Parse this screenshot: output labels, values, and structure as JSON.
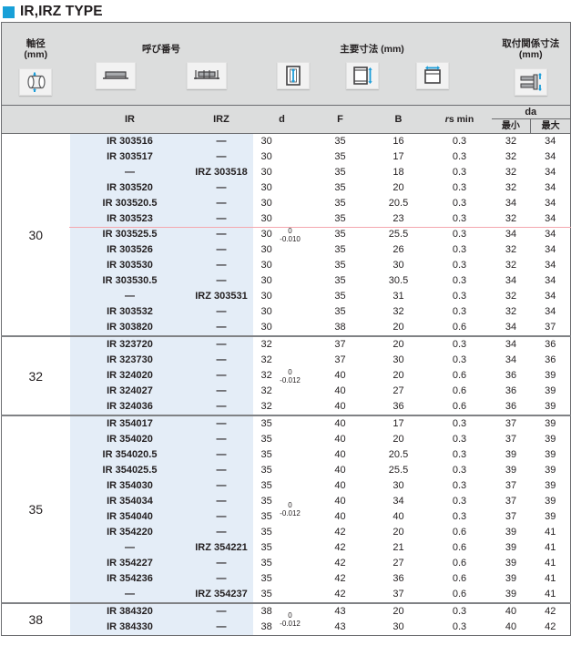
{
  "title": {
    "text": "IR,IRZ TYPE",
    "marker_color": "#18a0d8"
  },
  "header": {
    "shaft": {
      "line1": "軸径",
      "line2": "(mm)",
      "icon": "shaft-diameter-icon"
    },
    "designation": {
      "label": "呼び番号",
      "icons": [
        "ir-profile-icon",
        "irz-profile-icon"
      ]
    },
    "main_dims": {
      "label": "主要寸法 (mm)",
      "icons": [
        "dimension-d-icon",
        "dimension-f-icon",
        "dimension-b-icon"
      ]
    },
    "mounting": {
      "line1": "取付関係寸法",
      "line2": "(mm)",
      "icon": "mounting-dimension-icon"
    },
    "sub": {
      "ir": "IR",
      "irz": "IRZ",
      "d": "d",
      "f": "F",
      "b": "B",
      "rs_min_prefix": "r",
      "rs_min_suffix": "s min",
      "da": "da",
      "da_min": "最小",
      "da_max": "最大"
    }
  },
  "colors": {
    "name_bg": "#e4edf7",
    "header_bg": "#dcdddd",
    "highlight_line": "#f4a7ae",
    "accent": "#18a0d8",
    "border": "#6d6e71"
  },
  "dash": "—",
  "blocks": [
    {
      "shaft": "30",
      "tolerance": {
        "upper": "0",
        "lower": "-0.010"
      },
      "highlight_after_row": 6,
      "rows": [
        {
          "ir": "IR 303516",
          "irz": "—",
          "d": "30",
          "f": "35",
          "b": "16",
          "rs": "0.3",
          "da_min": "32",
          "da_max": "34"
        },
        {
          "ir": "IR 303517",
          "irz": "—",
          "d": "30",
          "f": "35",
          "b": "17",
          "rs": "0.3",
          "da_min": "32",
          "da_max": "34"
        },
        {
          "ir": "—",
          "irz": "IRZ 303518",
          "d": "30",
          "f": "35",
          "b": "18",
          "rs": "0.3",
          "da_min": "32",
          "da_max": "34"
        },
        {
          "ir": "IR 303520",
          "irz": "—",
          "d": "30",
          "f": "35",
          "b": "20",
          "rs": "0.3",
          "da_min": "32",
          "da_max": "34"
        },
        {
          "ir": "IR 303520.5",
          "irz": "—",
          "d": "30",
          "f": "35",
          "b": "20.5",
          "rs": "0.3",
          "da_min": "34",
          "da_max": "34"
        },
        {
          "ir": "IR 303523",
          "irz": "—",
          "d": "30",
          "f": "35",
          "b": "23",
          "rs": "0.3",
          "da_min": "32",
          "da_max": "34"
        },
        {
          "ir": "IR 303525.5",
          "irz": "—",
          "d": "30",
          "f": "35",
          "b": "25.5",
          "rs": "0.3",
          "da_min": "34",
          "da_max": "34"
        },
        {
          "ir": "IR 303526",
          "irz": "—",
          "d": "30",
          "f": "35",
          "b": "26",
          "rs": "0.3",
          "da_min": "32",
          "da_max": "34"
        },
        {
          "ir": "IR 303530",
          "irz": "—",
          "d": "30",
          "f": "35",
          "b": "30",
          "rs": "0.3",
          "da_min": "32",
          "da_max": "34"
        },
        {
          "ir": "IR 303530.5",
          "irz": "—",
          "d": "30",
          "f": "35",
          "b": "30.5",
          "rs": "0.3",
          "da_min": "34",
          "da_max": "34"
        },
        {
          "ir": "—",
          "irz": "IRZ 303531",
          "d": "30",
          "f": "35",
          "b": "31",
          "rs": "0.3",
          "da_min": "32",
          "da_max": "34"
        },
        {
          "ir": "IR 303532",
          "irz": "—",
          "d": "30",
          "f": "35",
          "b": "32",
          "rs": "0.3",
          "da_min": "32",
          "da_max": "34"
        },
        {
          "ir": "IR 303820",
          "irz": "—",
          "d": "30",
          "f": "38",
          "b": "20",
          "rs": "0.6",
          "da_min": "34",
          "da_max": "37"
        }
      ]
    },
    {
      "shaft": "32",
      "tolerance": {
        "upper": "0",
        "lower": "-0.012"
      },
      "highlight_after_row": 0,
      "rows": [
        {
          "ir": "IR 323720",
          "irz": "—",
          "d": "32",
          "f": "37",
          "b": "20",
          "rs": "0.3",
          "da_min": "34",
          "da_max": "36"
        },
        {
          "ir": "IR 323730",
          "irz": "—",
          "d": "32",
          "f": "37",
          "b": "30",
          "rs": "0.3",
          "da_min": "34",
          "da_max": "36"
        },
        {
          "ir": "IR 324020",
          "irz": "—",
          "d": "32",
          "f": "40",
          "b": "20",
          "rs": "0.6",
          "da_min": "36",
          "da_max": "39"
        },
        {
          "ir": "IR 324027",
          "irz": "—",
          "d": "32",
          "f": "40",
          "b": "27",
          "rs": "0.6",
          "da_min": "36",
          "da_max": "39"
        },
        {
          "ir": "IR 324036",
          "irz": "—",
          "d": "32",
          "f": "40",
          "b": "36",
          "rs": "0.6",
          "da_min": "36",
          "da_max": "39"
        }
      ]
    },
    {
      "shaft": "35",
      "tolerance": {
        "upper": "0",
        "lower": "-0.012"
      },
      "highlight_after_row": 0,
      "rows": [
        {
          "ir": "IR 354017",
          "irz": "—",
          "d": "35",
          "f": "40",
          "b": "17",
          "rs": "0.3",
          "da_min": "37",
          "da_max": "39"
        },
        {
          "ir": "IR 354020",
          "irz": "—",
          "d": "35",
          "f": "40",
          "b": "20",
          "rs": "0.3",
          "da_min": "37",
          "da_max": "39"
        },
        {
          "ir": "IR 354020.5",
          "irz": "—",
          "d": "35",
          "f": "40",
          "b": "20.5",
          "rs": "0.3",
          "da_min": "39",
          "da_max": "39"
        },
        {
          "ir": "IR 354025.5",
          "irz": "—",
          "d": "35",
          "f": "40",
          "b": "25.5",
          "rs": "0.3",
          "da_min": "39",
          "da_max": "39"
        },
        {
          "ir": "IR 354030",
          "irz": "—",
          "d": "35",
          "f": "40",
          "b": "30",
          "rs": "0.3",
          "da_min": "37",
          "da_max": "39"
        },
        {
          "ir": "IR 354034",
          "irz": "—",
          "d": "35",
          "f": "40",
          "b": "34",
          "rs": "0.3",
          "da_min": "37",
          "da_max": "39"
        },
        {
          "ir": "IR 354040",
          "irz": "—",
          "d": "35",
          "f": "40",
          "b": "40",
          "rs": "0.3",
          "da_min": "37",
          "da_max": "39"
        },
        {
          "ir": "IR 354220",
          "irz": "—",
          "d": "35",
          "f": "42",
          "b": "20",
          "rs": "0.6",
          "da_min": "39",
          "da_max": "41"
        },
        {
          "ir": "—",
          "irz": "IRZ 354221",
          "d": "35",
          "f": "42",
          "b": "21",
          "rs": "0.6",
          "da_min": "39",
          "da_max": "41"
        },
        {
          "ir": "IR 354227",
          "irz": "—",
          "d": "35",
          "f": "42",
          "b": "27",
          "rs": "0.6",
          "da_min": "39",
          "da_max": "41"
        },
        {
          "ir": "IR 354236",
          "irz": "—",
          "d": "35",
          "f": "42",
          "b": "36",
          "rs": "0.6",
          "da_min": "39",
          "da_max": "41"
        },
        {
          "ir": "—",
          "irz": "IRZ 354237",
          "d": "35",
          "f": "42",
          "b": "37",
          "rs": "0.6",
          "da_min": "39",
          "da_max": "41"
        }
      ]
    },
    {
      "shaft": "38",
      "tolerance": {
        "upper": "0",
        "lower": "-0.012"
      },
      "highlight_after_row": 0,
      "rows": [
        {
          "ir": "IR 384320",
          "irz": "—",
          "d": "38",
          "f": "43",
          "b": "20",
          "rs": "0.3",
          "da_min": "40",
          "da_max": "42"
        },
        {
          "ir": "IR 384330",
          "irz": "—",
          "d": "38",
          "f": "43",
          "b": "30",
          "rs": "0.3",
          "da_min": "40",
          "da_max": "42"
        }
      ]
    }
  ]
}
